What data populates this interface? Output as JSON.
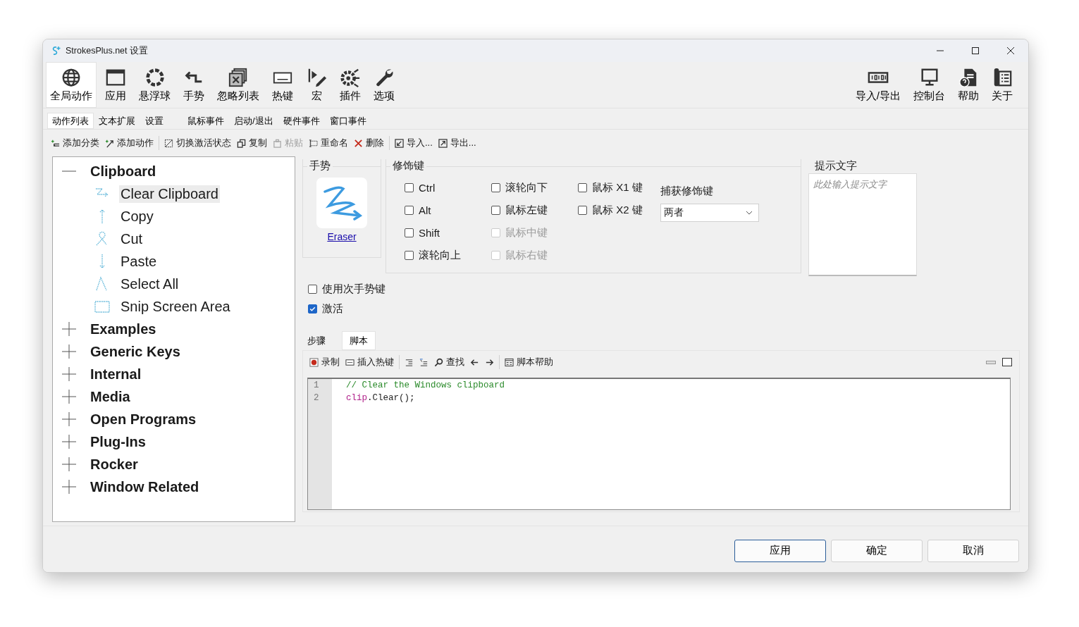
{
  "window": {
    "title": "StrokesPlus.net 设置"
  },
  "main_toolbar": [
    {
      "label": "全局动作",
      "kind": "globe",
      "selected": true
    },
    {
      "label": "应用",
      "kind": "window",
      "selected": false
    },
    {
      "label": "悬浮球",
      "kind": "ring",
      "selected": false
    },
    {
      "label": "手势",
      "kind": "gesture",
      "selected": false
    },
    {
      "label": "忽略列表",
      "kind": "ignore",
      "selected": false
    },
    {
      "label": "热键",
      "kind": "abc",
      "selected": false
    },
    {
      "label": "宏",
      "kind": "macro",
      "selected": false
    },
    {
      "label": "插件",
      "kind": "plugin",
      "selected": false
    },
    {
      "label": "选项",
      "kind": "wrench",
      "selected": false
    }
  ],
  "right_toolbar": [
    {
      "label": "导入/导出",
      "kind": "binary",
      "selected": false
    },
    {
      "label": "控制台",
      "kind": "monitor",
      "selected": false
    },
    {
      "label": "帮助",
      "kind": "help",
      "selected": false
    },
    {
      "label": "关于",
      "kind": "about",
      "selected": false
    }
  ],
  "tabs": [
    {
      "label": "动作列表",
      "selected": true
    },
    {
      "label": "文本扩展",
      "selected": false
    },
    {
      "label": "设置",
      "selected": false
    },
    {
      "label": "鼠标事件",
      "selected": false
    },
    {
      "label": "启动/退出",
      "selected": false
    },
    {
      "label": "硬件事件",
      "selected": false
    },
    {
      "label": "窗口事件",
      "selected": false
    }
  ],
  "actions": [
    {
      "label": "添加分类",
      "kind": "addcat",
      "disabled": false
    },
    {
      "label": "添加动作",
      "kind": "addact",
      "disabled": false
    },
    {
      "label": "切换激活状态",
      "kind": "toggle",
      "disabled": false
    },
    {
      "label": "复制",
      "kind": "copy",
      "disabled": false
    },
    {
      "label": "粘贴",
      "kind": "paste",
      "disabled": true
    },
    {
      "label": "重命名",
      "kind": "rename",
      "disabled": false
    },
    {
      "label": "删除",
      "kind": "delete",
      "disabled": false
    },
    {
      "label": "导入...",
      "kind": "import",
      "disabled": false
    },
    {
      "label": "导出...",
      "kind": "export",
      "disabled": false
    }
  ],
  "tree": [
    {
      "label": "Clipboard",
      "expanded": true,
      "selected": false,
      "children": [
        {
          "label": "Clear Clipboard",
          "kind": "z",
          "selected": true
        },
        {
          "label": "Copy",
          "kind": "up",
          "selected": false
        },
        {
          "label": "Cut",
          "kind": "loop",
          "selected": false
        },
        {
          "label": "Paste",
          "kind": "down",
          "selected": false
        },
        {
          "label": "Select All",
          "kind": "caret",
          "selected": false
        },
        {
          "label": "Snip Screen Area",
          "kind": "rect",
          "selected": false
        }
      ]
    },
    {
      "label": "Examples",
      "expanded": false,
      "selected": false
    },
    {
      "label": "Generic Keys",
      "expanded": false,
      "selected": false
    },
    {
      "label": "Internal",
      "expanded": false,
      "selected": false
    },
    {
      "label": "Media",
      "expanded": false,
      "selected": false
    },
    {
      "label": "Open Programs",
      "expanded": false,
      "selected": false
    },
    {
      "label": "Plug-Ins",
      "expanded": false,
      "selected": false
    },
    {
      "label": "Rocker",
      "expanded": false,
      "selected": false
    },
    {
      "label": "Window Related",
      "expanded": false,
      "selected": false
    }
  ],
  "gesture": {
    "title": "手势",
    "name": "Eraser"
  },
  "modifiers": {
    "title": "修饰键",
    "columns": [
      [
        {
          "label": "Ctrl",
          "checked": false,
          "disabled": false
        },
        {
          "label": "Alt",
          "checked": false,
          "disabled": false
        },
        {
          "label": "Shift",
          "checked": false,
          "disabled": false
        },
        {
          "label": "滚轮向上",
          "checked": false,
          "disabled": false
        }
      ],
      [
        {
          "label": "滚轮向下",
          "checked": false,
          "disabled": false
        },
        {
          "label": "鼠标左键",
          "checked": false,
          "disabled": false
        },
        {
          "label": "鼠标中键",
          "checked": false,
          "disabled": true
        },
        {
          "label": "鼠标右键",
          "checked": false,
          "disabled": true
        }
      ],
      [
        {
          "label": "鼠标 X1 键",
          "checked": false,
          "disabled": false
        },
        {
          "label": "鼠标 X2 键",
          "checked": false,
          "disabled": false
        }
      ]
    ],
    "capture_label": "捕获修饰键",
    "capture_value": "两者"
  },
  "hint": {
    "title": "提示文字",
    "placeholder": "此处输入提示文字"
  },
  "options": [
    {
      "label": "使用次手势键",
      "checked": false
    },
    {
      "label": "激活",
      "checked": true
    }
  ],
  "script_tabs": [
    {
      "label": "步骤",
      "selected": false
    },
    {
      "label": "脚本",
      "selected": true
    }
  ],
  "script_toolbar": [
    {
      "label": "录制",
      "kind": "record"
    },
    {
      "label": "插入热键",
      "kind": "abc"
    },
    {
      "kind": "indent"
    },
    {
      "kind": "comment"
    },
    {
      "label": "查找",
      "kind": "search"
    },
    {
      "kind": "back"
    },
    {
      "kind": "forward"
    },
    {
      "label": "脚本帮助",
      "kind": "scripthelp"
    }
  ],
  "code_lines": [
    {
      "number": "1",
      "tokens": [
        {
          "kind": "comment",
          "text": "// Clear the Windows clipboard"
        }
      ]
    },
    {
      "number": "2",
      "tokens": [
        {
          "kind": "ident",
          "text": "clip"
        },
        {
          "kind": "plain",
          "text": ".Clear();"
        }
      ]
    }
  ],
  "buttons": [
    {
      "label": "应用",
      "selected": true
    },
    {
      "label": "确定",
      "selected": false
    },
    {
      "label": "取消",
      "selected": false
    }
  ]
}
